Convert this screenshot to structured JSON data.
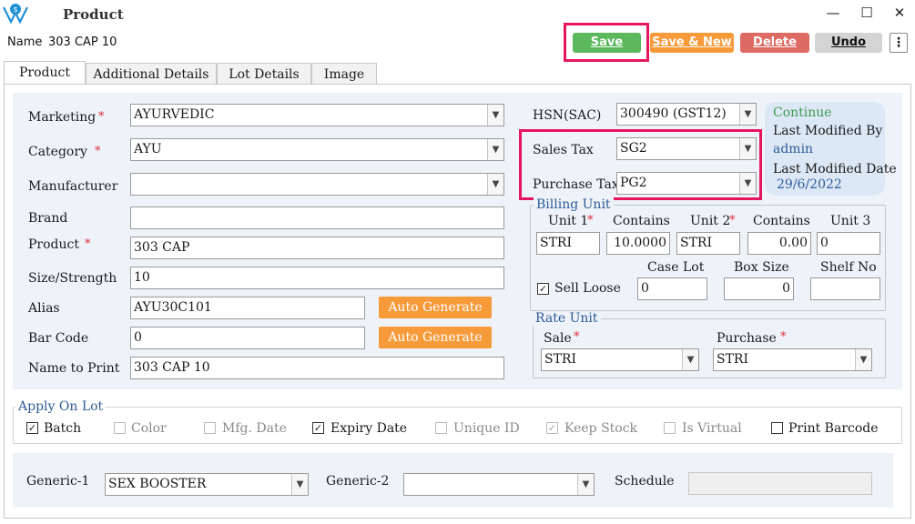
{
  "window": {
    "title": "Product",
    "minimize": "—",
    "maximize": "☐",
    "close": "✕"
  },
  "name": {
    "label": "Name",
    "value": "303 CAP 10"
  },
  "toolbar": {
    "save": "Save",
    "save_new": "Save & New",
    "delete": "Delete",
    "undo": "Undo",
    "more": "⋮",
    "colors": {
      "save": "#5cb85c",
      "save_new": "#f79a3a",
      "delete": "#dd6b63",
      "undo": "#d4d4d4"
    }
  },
  "tabs": [
    "Product",
    "Additional Details",
    "Lot Details",
    "Image"
  ],
  "form": {
    "marketing": {
      "label": "Marketing",
      "value": "AYURVEDIC"
    },
    "category": {
      "label": "Category",
      "value": "AYU"
    },
    "manufacturer": {
      "label": "Manufacturer",
      "value": ""
    },
    "brand": {
      "label": "Brand",
      "value": ""
    },
    "product": {
      "label": "Product",
      "value": "303 CAP"
    },
    "size": {
      "label": "Size/Strength",
      "value": "10"
    },
    "alias": {
      "label": "Alias",
      "value": "AYU30C101",
      "button": "Auto Generate"
    },
    "barcode": {
      "label": "Bar Code",
      "value": "0",
      "button": "Auto Generate"
    },
    "name_to_print": {
      "label": "Name to Print",
      "value": "303 CAP 10"
    },
    "required_mark": "*"
  },
  "tax": {
    "hsn": {
      "label": "HSN(SAC)",
      "value": "300490 (GST12)"
    },
    "sales": {
      "label": "Sales Tax",
      "value": "SG2"
    },
    "purchase": {
      "label": "Purchase Tax",
      "value": "PG2"
    }
  },
  "info": {
    "status": "Continue",
    "modified_by_label": "Last Modified By",
    "modified_by": "admin",
    "modified_date_label": "Last Modified Date",
    "modified_date": "29/6/2022"
  },
  "billing": {
    "title": "Billing Unit",
    "unit1_label": "Unit 1",
    "contains1_label": "Contains",
    "unit2_label": "Unit 2",
    "contains2_label": "Contains",
    "unit3_label": "Unit 3",
    "unit1": "STRI",
    "contains1": "10.0000",
    "unit2": "STRI",
    "contains2": "0.00",
    "unit3": "0",
    "sell_loose": "Sell Loose",
    "case_lot_label": "Case Lot",
    "case_lot": "0",
    "box_size_label": "Box Size",
    "box_size": "0",
    "shelf_label": "Shelf No",
    "shelf": ""
  },
  "rate": {
    "title": "Rate Unit",
    "sale_label": "Sale",
    "sale": "STRI",
    "purchase_label": "Purchase",
    "purchase": "STRI"
  },
  "lot": {
    "title": "Apply On Lot",
    "options": [
      "Batch",
      "Color",
      "Mfg. Date",
      "Expiry Date",
      "Unique ID",
      "Keep Stock",
      "Is Virtual",
      "Print Barcode"
    ]
  },
  "generic": {
    "g1_label": "Generic-1",
    "g1": "SEX BOOSTER",
    "g2_label": "Generic-2",
    "g2": "",
    "schedule_label": "Schedule",
    "schedule": ""
  }
}
